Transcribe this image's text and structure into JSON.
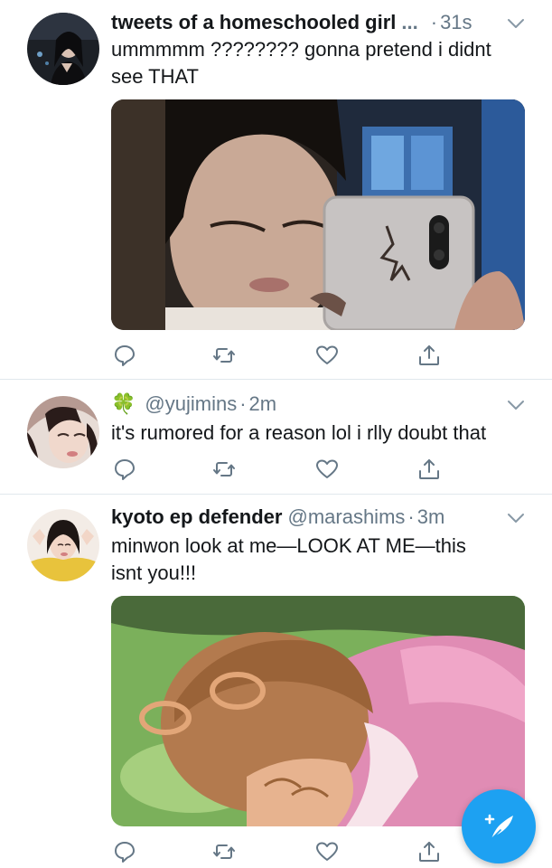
{
  "tweets": [
    {
      "display_name": "tweets of a homeschooled girl",
      "name_truncation": "...",
      "handle": "",
      "separator": "·",
      "time": "31s",
      "text": "ummmmm ???????? gonna pretend i didnt see THAT",
      "has_media": true,
      "media_icon": "photo-mirror-selfie"
    },
    {
      "display_name": "",
      "name_emoji": "🍀",
      "handle": "@yujimins",
      "separator": "·",
      "time": "2m",
      "text": "it's rumored for a reason lol i rlly doubt that",
      "has_media": false
    },
    {
      "display_name": "kyoto ep defender",
      "handle": "@marashims",
      "separator": "·",
      "time": "3m",
      "text": "minwon look at me—LOOK AT ME—this isnt you!!!",
      "has_media": true,
      "media_icon": "cartoon-face-in-hands"
    }
  ],
  "action_icons": [
    "reply-icon",
    "retweet-icon",
    "like-icon",
    "share-icon"
  ],
  "compose_icon": "compose-tweet-icon",
  "colors": {
    "accent": "#1da1f2",
    "text": "#14171a",
    "muted": "#657786",
    "divider": "#e1e8ed"
  }
}
